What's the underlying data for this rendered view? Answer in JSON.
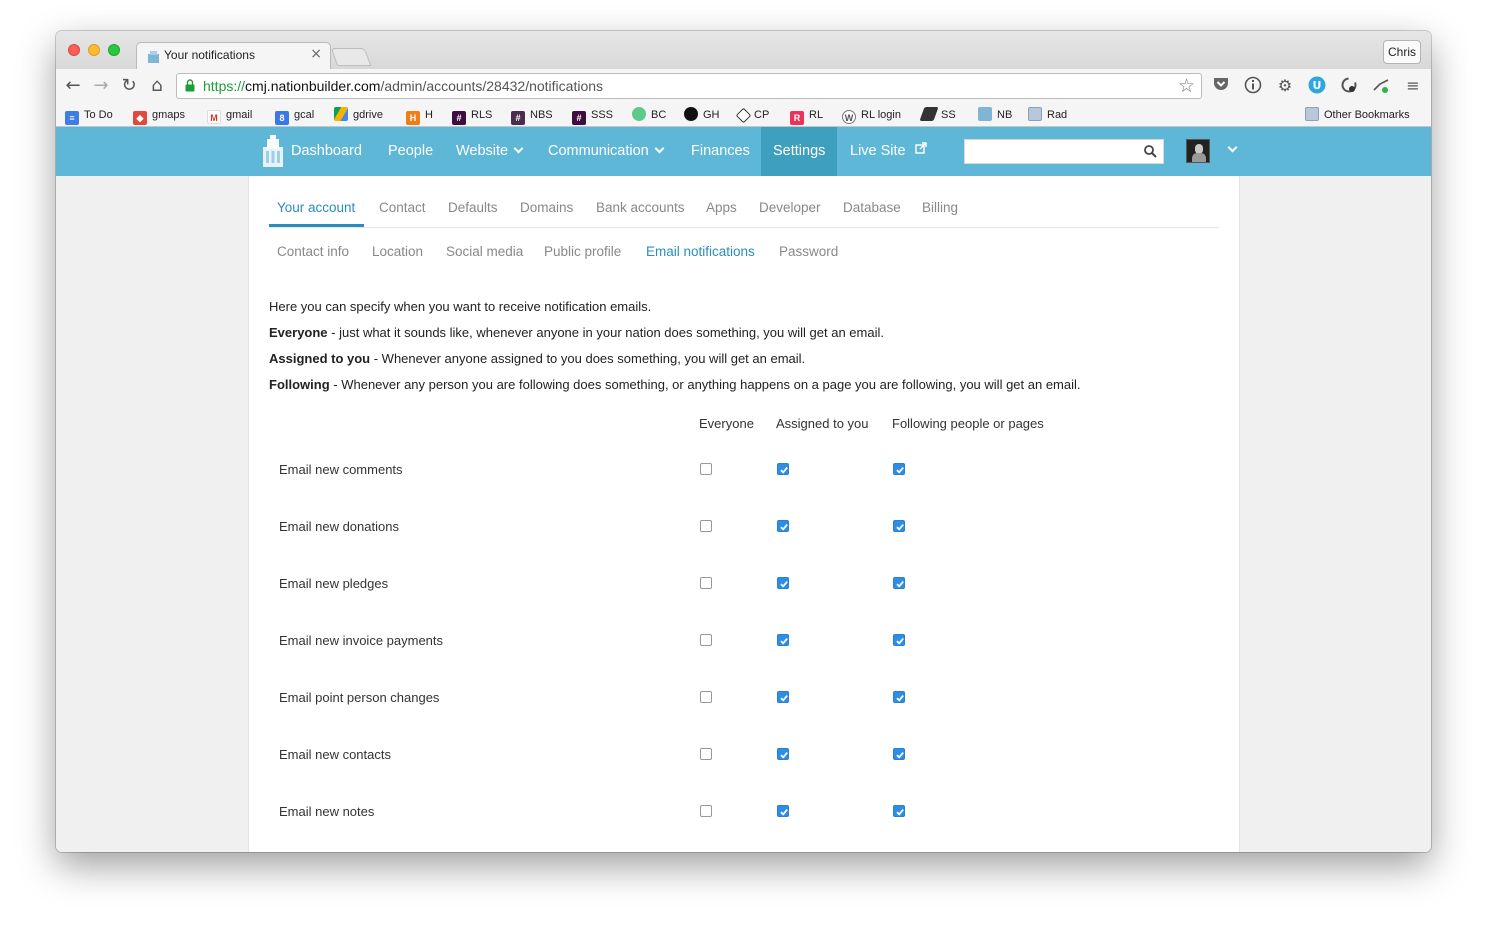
{
  "browser": {
    "tab_title": "Your notifications",
    "tab_close": "×",
    "profile_name": "Chris",
    "url_scheme": "https://",
    "url_host": "cmj.nationbuilder.com",
    "url_path": "/admin/accounts/28432/notifications"
  },
  "bookmarks": {
    "items": [
      "To Do",
      "gmaps",
      "gmail",
      "gcal",
      "gdrive",
      "H",
      "RLS",
      "NBS",
      "SSS",
      "BC",
      "GH",
      "CP",
      "RL",
      "RL login",
      "SS",
      "NB",
      "Rad"
    ],
    "other": "Other Bookmarks"
  },
  "sitenav": {
    "dashboard": "Dashboard",
    "people": "People",
    "website": "Website",
    "communication": "Communication",
    "finances": "Finances",
    "settings": "Settings",
    "live_site": "Live Site",
    "search_placeholder": ""
  },
  "tabs": {
    "primary": [
      "Your account",
      "Contact",
      "Defaults",
      "Domains",
      "Bank accounts",
      "Apps",
      "Developer",
      "Database",
      "Billing"
    ],
    "primary_active": "Your account",
    "secondary": [
      "Contact info",
      "Location",
      "Social media",
      "Public profile",
      "Email notifications",
      "Password"
    ],
    "secondary_active": "Email notifications"
  },
  "intro": {
    "line1": "Here you can specify when you want to receive notification emails.",
    "everyone_label": "Everyone",
    "everyone_text": " - just what it sounds like, whenever anyone in your nation does something, you will get an email.",
    "assigned_label": "Assigned to you",
    "assigned_text": " - Whenever anyone assigned to you does something, you will get an email.",
    "following_label": "Following",
    "following_text": " - Whenever any person you are following does something, or anything happens on a page you are following, you will get an email."
  },
  "table": {
    "columns": [
      "Everyone",
      "Assigned to you",
      "Following people or pages"
    ],
    "rows": [
      {
        "label": "Email new comments",
        "everyone": false,
        "assigned": true,
        "following": true
      },
      {
        "label": "Email new donations",
        "everyone": false,
        "assigned": true,
        "following": true
      },
      {
        "label": "Email new pledges",
        "everyone": false,
        "assigned": true,
        "following": true
      },
      {
        "label": "Email new invoice payments",
        "everyone": false,
        "assigned": true,
        "following": true
      },
      {
        "label": "Email point person changes",
        "everyone": false,
        "assigned": true,
        "following": true
      },
      {
        "label": "Email new contacts",
        "everyone": false,
        "assigned": true,
        "following": true
      },
      {
        "label": "Email new notes",
        "everyone": false,
        "assigned": true,
        "following": true
      }
    ]
  },
  "colors": {
    "nav_bg": "#5eb7d6",
    "nav_active": "#3f9fbf",
    "link_active": "#2b8cbe",
    "checkbox_on": "#2d8ee6"
  }
}
